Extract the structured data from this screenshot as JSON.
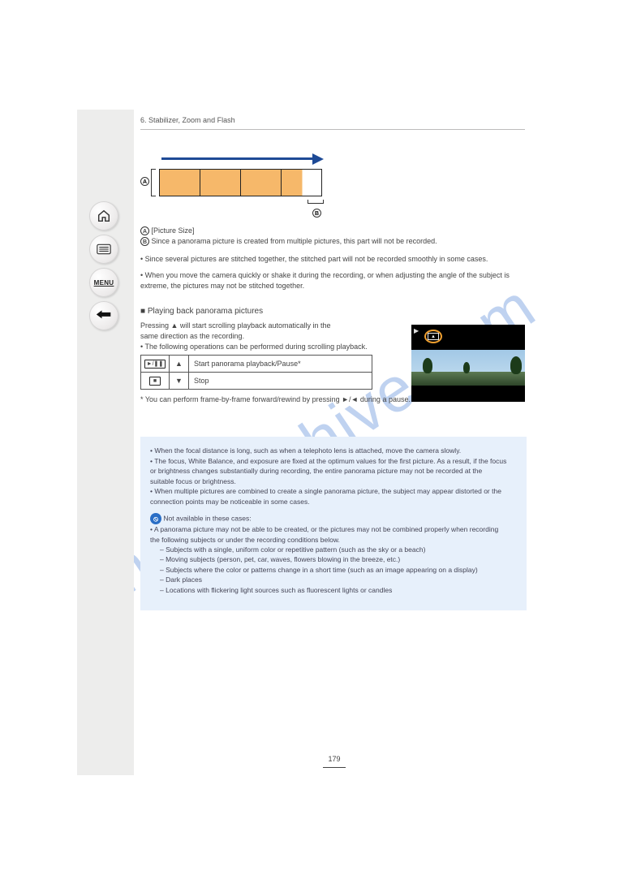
{
  "watermark": "manualshive.com",
  "header": {
    "chapter": "6.",
    "chapter_title": "Stabilizer, Zoom and Flash"
  },
  "diagram": {
    "labelA": "A",
    "labelB": "B"
  },
  "legend": {
    "a_key": "A",
    "a_text": "[Picture Size]",
    "b_key": "B",
    "b_text": "Since a panorama picture is created from multiple pictures, this part will not be recorded."
  },
  "dots1": [
    "Since several pictures are stitched together, the stitched part will not be recorded smoothly in some cases.",
    "When you move the camera quickly or shake it during the recording, or when adjusting the angle of the subject is extreme, the pictures may not be stitched together."
  ],
  "section_title": "■ Playing back panorama pictures",
  "play_intro": [
    "Pressing ▲ will start scrolling playback automatically in the",
    "same direction as the recording.",
    "• The following operations can be performed during scrolling playback."
  ],
  "table": {
    "row1_dir": "▲",
    "row1_text": "Start panorama playback/Pause*",
    "row2_dir": "▼",
    "row2_text": "Stop"
  },
  "footnote": "* You can perform frame-by-frame forward/rewind by pressing ►/◄ during a pause.",
  "notes": [
    {
      "cls": "dot",
      "t": "When the focal distance is long, such as when a telephoto lens is attached, move the camera slowly."
    },
    {
      "cls": "dot",
      "t": "The focus, White Balance, and exposure are fixed at the optimum values for the first picture. As a result, if the focus"
    },
    {
      "cls": "",
      "t": "or brightness changes substantially during recording, the entire panorama picture may not be recorded at the"
    },
    {
      "cls": "",
      "t": "suitable focus or brightness."
    },
    {
      "cls": "dot",
      "t": "When multiple pictures are combined to create a single panorama picture, the subject may appear distorted or the"
    },
    {
      "cls": "",
      "t": "connection points may be noticeable in some cases."
    },
    {
      "cls": "notify",
      "t": "Not available in these cases:"
    },
    {
      "cls": "dot",
      "t": "A panorama picture may not be able to be created, or the pictures may not be combined properly when recording"
    },
    {
      "cls": "",
      "t": "the following subjects or under the recording conditions below."
    },
    {
      "cls": "dash",
      "t": "Subjects with a single, uniform color or repetitive pattern (such as the sky or a beach)"
    },
    {
      "cls": "dash",
      "t": "Moving subjects (person, pet, car, waves, flowers blowing in the breeze, etc.)"
    },
    {
      "cls": "dash",
      "t": "Subjects where the color or patterns change in a short time (such as an image appearing on a display)"
    },
    {
      "cls": "dash",
      "t": "Dark places"
    },
    {
      "cls": "dash",
      "t": "Locations with flickering light sources such as fluorescent lights or candles"
    }
  ],
  "pagenum": "179"
}
